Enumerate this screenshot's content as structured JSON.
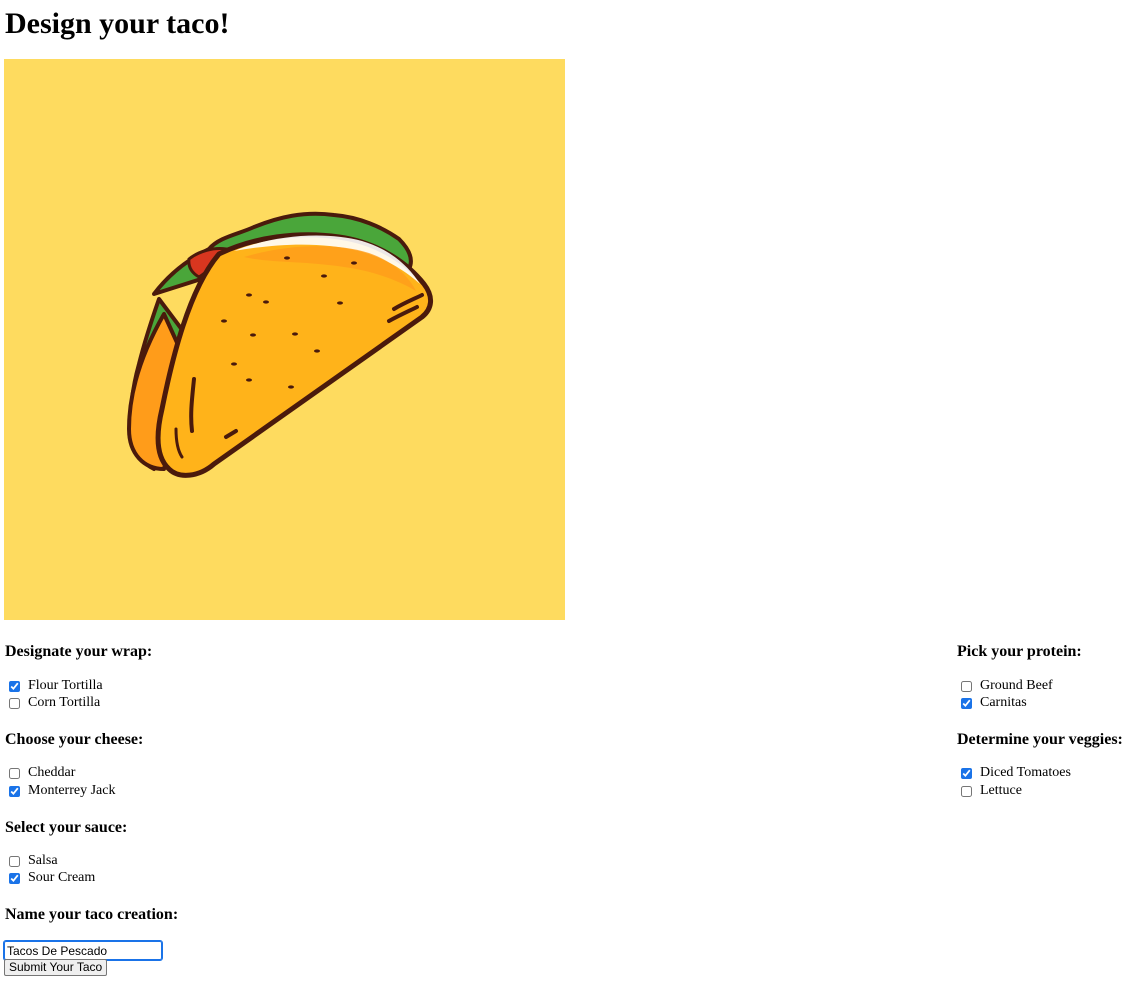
{
  "page": {
    "title": "Design your taco!"
  },
  "image": {
    "icon": "taco-illustration",
    "background": "#fedb5f"
  },
  "sections": {
    "wrap": {
      "heading": "Designate your wrap:",
      "options": [
        {
          "label": "Flour Tortilla",
          "checked": true
        },
        {
          "label": "Corn Tortilla",
          "checked": false
        }
      ]
    },
    "cheese": {
      "heading": "Choose your cheese:",
      "options": [
        {
          "label": "Cheddar",
          "checked": false
        },
        {
          "label": "Monterrey Jack",
          "checked": true
        }
      ]
    },
    "sauce": {
      "heading": "Select your sauce:",
      "options": [
        {
          "label": "Salsa",
          "checked": false
        },
        {
          "label": "Sour Cream",
          "checked": true
        }
      ]
    },
    "name": {
      "heading": "Name your taco creation:"
    },
    "protein": {
      "heading": "Pick your protein:",
      "options": [
        {
          "label": "Ground Beef",
          "checked": false
        },
        {
          "label": "Carnitas",
          "checked": true
        }
      ]
    },
    "veggies": {
      "heading": "Determine your veggies:",
      "options": [
        {
          "label": "Diced Tomatoes",
          "checked": true
        },
        {
          "label": "Lettuce",
          "checked": false
        }
      ]
    }
  },
  "form": {
    "name_value": "Tacos De Pescado",
    "submit_label": "Submit Your Taco"
  },
  "colors": {
    "accent": "#1a73e8",
    "taco_shell": "#ffb31a",
    "lettuce": "#4aa63a",
    "tomato": "#d9361f",
    "outline": "#4a1a0c"
  }
}
